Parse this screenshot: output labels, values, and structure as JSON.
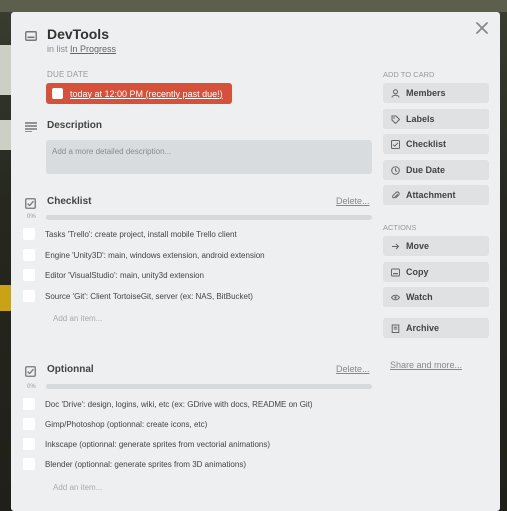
{
  "card": {
    "title": "DevTools",
    "list_prefix": "in list",
    "list_name": "In Progress"
  },
  "due": {
    "label": "DUE DATE",
    "value": "today at 12:00 PM (recently past due!)",
    "color": "#d7513a"
  },
  "description": {
    "title": "Description",
    "placeholder": "Add a more detailed description..."
  },
  "checklists": [
    {
      "title": "Checklist",
      "delete_label": "Delete...",
      "percent": "0%",
      "progress": 0,
      "items": [
        "Tasks 'Trello': create project, install mobile Trello client",
        "Engine 'Unity3D': main, windows extension, android extension",
        "Editor 'VisualStudio': main, unity3d extension",
        "Source 'Git': Client TortoiseGit, server (ex: NAS, BitBucket)"
      ],
      "add_item": "Add an item..."
    },
    {
      "title": "Optionnal",
      "delete_label": "Delete...",
      "percent": "0%",
      "progress": 0,
      "items": [
        "Doc 'Drive': design, logins, wiki, etc (ex: GDrive with docs, README on Git)",
        "Gimp/Photoshop (optionnal: create icons, etc)",
        "Inkscape (optionnal: generate sprites from vectorial animations)",
        "Blender (optionnal: generate sprites from 3D animations)"
      ],
      "add_item": "Add an item..."
    }
  ],
  "sidebar": {
    "add_label": "ADD TO CARD",
    "add_buttons": [
      {
        "label": "Members",
        "icon": "person-icon"
      },
      {
        "label": "Labels",
        "icon": "tag-icon"
      },
      {
        "label": "Checklist",
        "icon": "checkbox-icon"
      },
      {
        "label": "Due Date",
        "icon": "clock-icon"
      },
      {
        "label": "Attachment",
        "icon": "paperclip-icon"
      }
    ],
    "actions_label": "ACTIONS",
    "action_buttons": [
      {
        "label": "Move",
        "icon": "arrow-right-icon"
      },
      {
        "label": "Copy",
        "icon": "card-icon"
      },
      {
        "label": "Watch",
        "icon": "eye-icon"
      }
    ],
    "archive_label": "Archive",
    "share_label": "Share and more..."
  },
  "colors": {
    "modal_bg": "#edeff0",
    "due_red": "#d7513a",
    "button_bg": "#dfe1e3"
  }
}
